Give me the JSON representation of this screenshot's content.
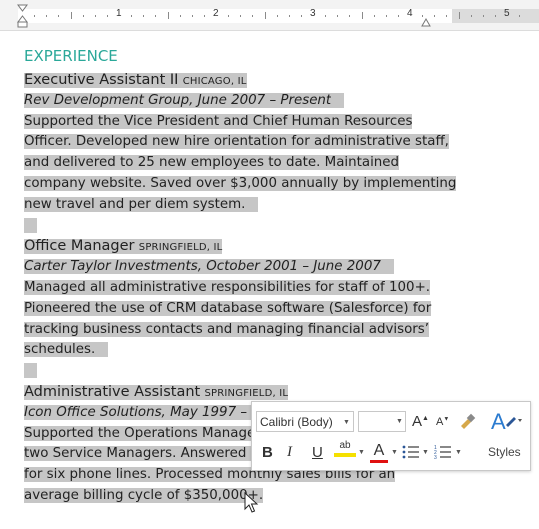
{
  "ruler": {
    "numbers": [
      "1",
      "2",
      "3",
      "4",
      "5"
    ]
  },
  "document": {
    "heading": "EXPERIENCE",
    "jobs": [
      {
        "title": "Executive Assistant II",
        "city": "CHICAGO, IL",
        "company": "Rev Development Group, June 2007 – Present",
        "description": [
          "Supported the Vice President and Chief Human Resources",
          "Officer. Developed new hire orientation for administrative staff,",
          "and delivered to 25 new employees to date. Maintained",
          "company website. Saved over $3,000 annually by implementing",
          "new travel and per diem system."
        ]
      },
      {
        "title": "Office Manager",
        "city": "SPRINGFIELD, IL",
        "company": "Carter Taylor Investments, October 2001 – June 2007",
        "description": [
          "Managed all administrative responsibilities for staff of 100+.",
          "Pioneered the use of CRM database software (Salesforce) for",
          "tracking business contacts and managing financial advisors’",
          "schedules."
        ]
      },
      {
        "title": "Administrative Assistant",
        "city": "SPRINGFIELD, IL",
        "company": "Icon Office Solutions, May 1997 – C",
        "description": [
          "Supported the Operations Manage",
          "two Service Managers. Answered a",
          "for six phone lines. Processed monthly sales bills for an",
          "average billing cycle of $350,000+."
        ]
      }
    ]
  },
  "mini_toolbar": {
    "font_name": "Calibri (Body)",
    "font_size": "",
    "grow_font": "A",
    "shrink_font": "A",
    "bold": "B",
    "italic": "I",
    "underline": "U",
    "highlight_text": "ab",
    "font_color_text": "A",
    "styles_label": "Styles",
    "highlight_color": "#f5e000",
    "font_color": "#e01010"
  },
  "colors": {
    "heading": "#2aa899",
    "selection": "#c6c6c6",
    "accent": "#2b5797"
  }
}
